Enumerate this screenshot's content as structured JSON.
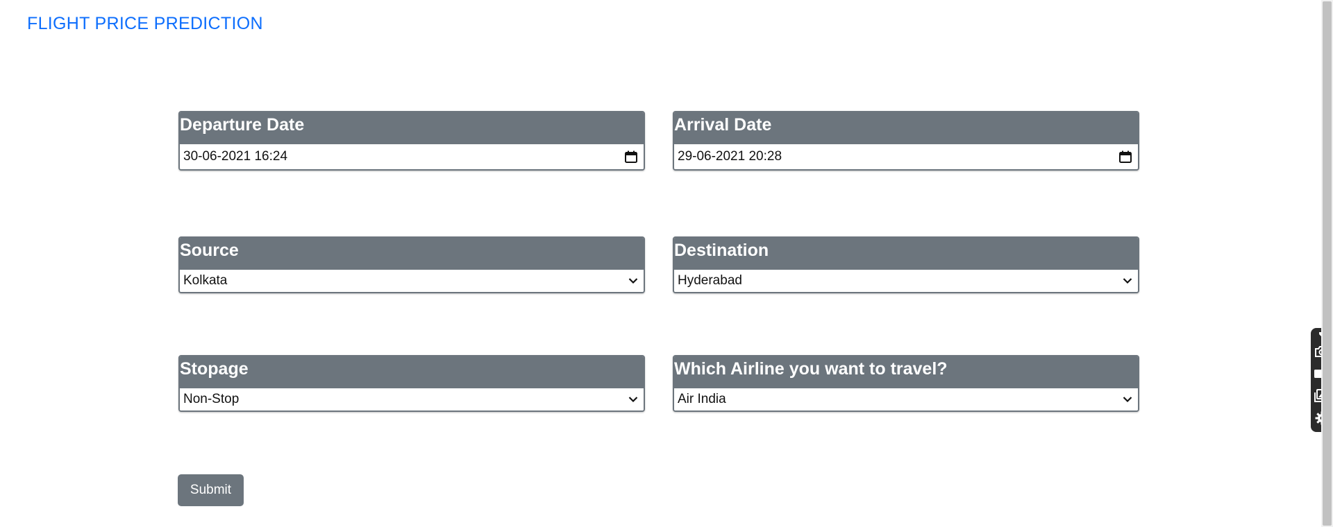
{
  "brand": {
    "title": "FLIGHT PRICE PREDICTION"
  },
  "form": {
    "departure": {
      "label": "Departure Date",
      "value": "30-06-2021 16:24"
    },
    "arrival": {
      "label": "Arrival Date",
      "value": "29-06-2021 20:28"
    },
    "source": {
      "label": "Source",
      "value": "Kolkata"
    },
    "destination": {
      "label": "Destination",
      "value": "Hyderabad"
    },
    "stopage": {
      "label": "Stopage",
      "value": "Non-Stop"
    },
    "airline": {
      "label": "Which Airline you want to travel?",
      "value": "Air India"
    },
    "submit_label": "Submit"
  },
  "toolbar": {
    "icons": [
      "pin-icon",
      "camera-icon",
      "video-camera-icon",
      "gallery-icon",
      "gear-icon"
    ]
  },
  "colors": {
    "brand": "#0d6efd",
    "header_bg": "#6c757d",
    "button_bg": "#6c757d"
  }
}
